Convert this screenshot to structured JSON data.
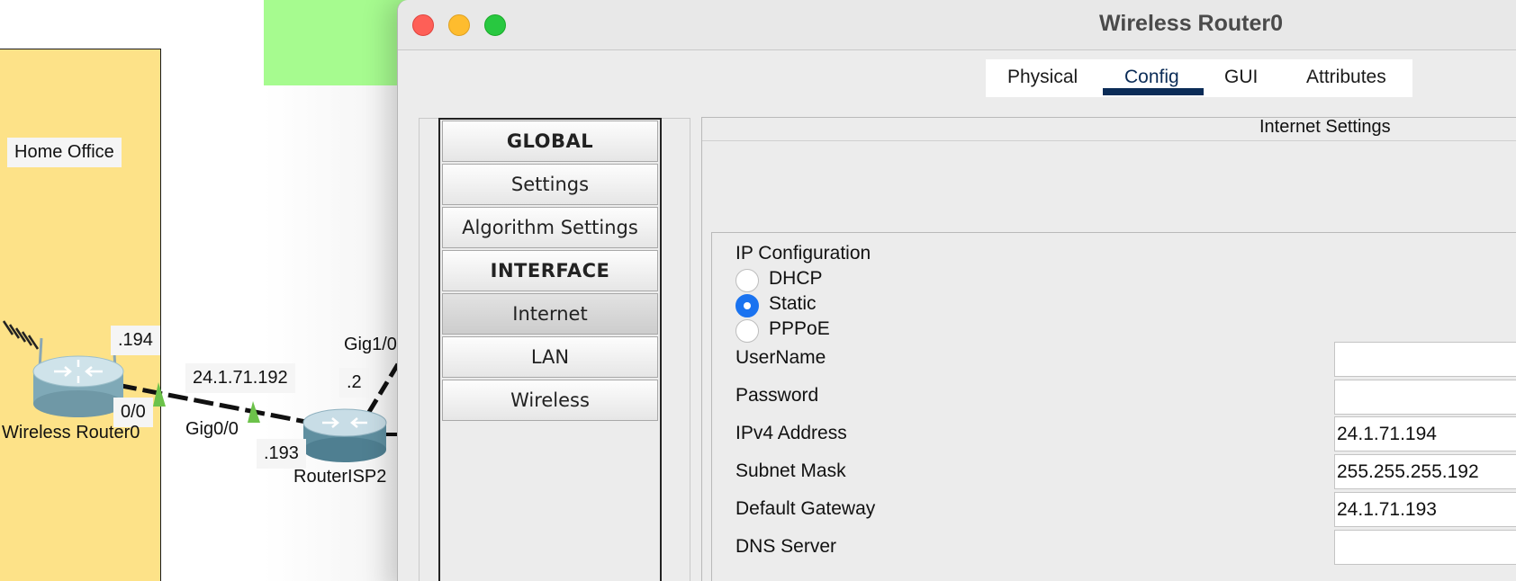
{
  "topology": {
    "home_office_label": "Home Office",
    "wireless_router": {
      "ip_suffix": ".194",
      "port": "0/0",
      "name": "Wireless Router0"
    },
    "link_network": "24.1.71.192",
    "isp_router": {
      "port_left": "Gig0/0",
      "ip_left": ".193",
      "port_up": "Gig1/0",
      "ip_up": ".2",
      "name": "RouterISP2"
    }
  },
  "window": {
    "title": "Wireless Router0",
    "tabs": [
      {
        "label": "Physical",
        "active": false
      },
      {
        "label": "Config",
        "active": true
      },
      {
        "label": "GUI",
        "active": false
      },
      {
        "label": "Attributes",
        "active": false
      }
    ]
  },
  "nav": {
    "items": [
      {
        "label": "GLOBAL",
        "type": "header"
      },
      {
        "label": "Settings",
        "type": "item"
      },
      {
        "label": "Algorithm Settings",
        "type": "item"
      },
      {
        "label": "INTERFACE",
        "type": "header"
      },
      {
        "label": "Internet",
        "type": "item",
        "selected": true
      },
      {
        "label": "LAN",
        "type": "item"
      },
      {
        "label": "Wireless",
        "type": "item"
      }
    ]
  },
  "panel": {
    "title": "Internet Settings",
    "ip_configuration_label": "IP Configuration",
    "options": [
      {
        "label": "DHCP",
        "checked": false
      },
      {
        "label": "Static",
        "checked": true
      },
      {
        "label": "PPPoE",
        "checked": false
      }
    ],
    "fields": [
      {
        "label": "UserName",
        "value": ""
      },
      {
        "label": "Password",
        "value": ""
      },
      {
        "label": "IPv4 Address",
        "value": "24.1.71.194"
      },
      {
        "label": "Subnet Mask",
        "value": "255.255.255.192"
      },
      {
        "label": "Default Gateway",
        "value": "24.1.71.193"
      },
      {
        "label": "DNS Server",
        "value": ""
      }
    ]
  },
  "colors": {
    "home_office_zone": "#fde288",
    "green_zone": "#a6fb8f",
    "link_up_indicator": "#6cc24a",
    "radio_selected": "#1a73f0",
    "tab_active": "#0b2c57",
    "traffic_close": "#fe5f57",
    "traffic_minimize": "#febc2e",
    "traffic_maximize": "#28c840"
  }
}
